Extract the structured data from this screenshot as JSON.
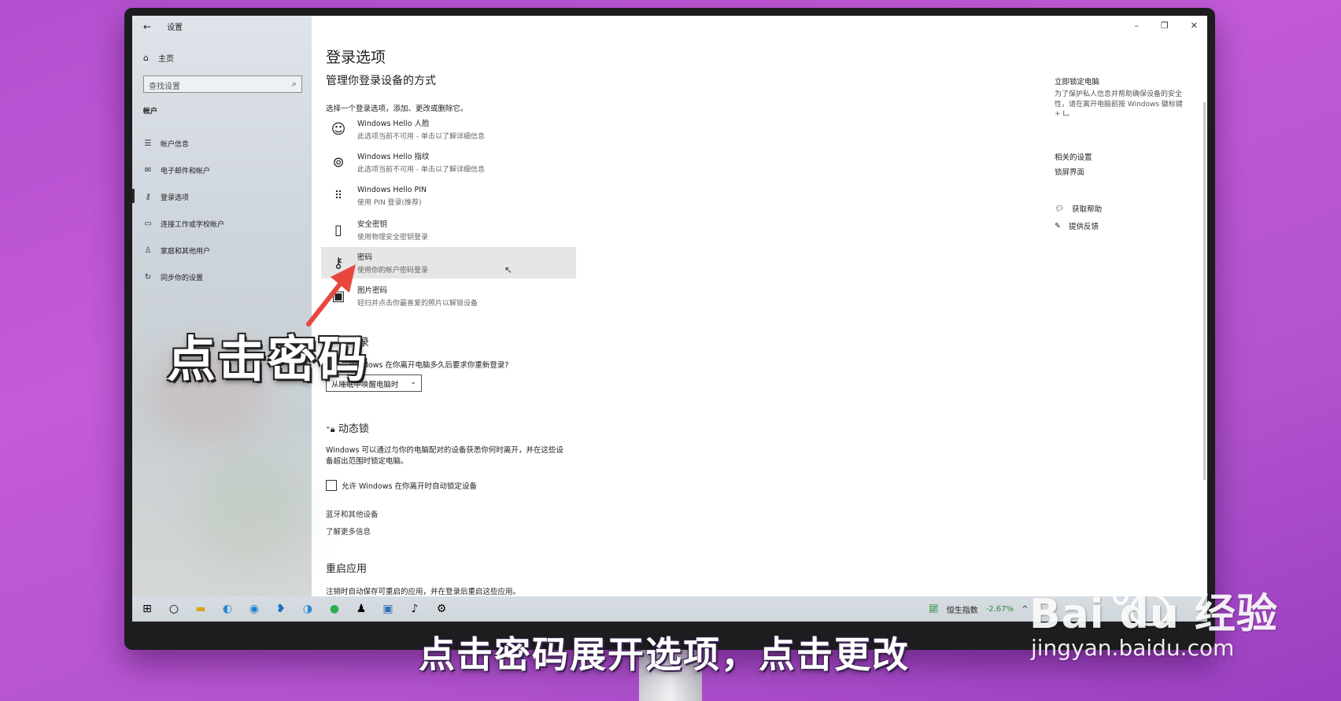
{
  "window": {
    "back_icon": "back-arrow-icon",
    "title": "设置",
    "minimize": "–",
    "restore": "❐",
    "close": "✕"
  },
  "sidebar": {
    "home_label": "主页",
    "search_placeholder": "查找设置",
    "section_label": "帐户",
    "items": [
      {
        "label": "帐户信息",
        "icon": "person-card-icon"
      },
      {
        "label": "电子邮件和帐户",
        "icon": "mail-icon"
      },
      {
        "label": "登录选项",
        "icon": "key-icon"
      },
      {
        "label": "连接工作或学校帐户",
        "icon": "briefcase-icon"
      },
      {
        "label": "家庭和其他用户",
        "icon": "person-icon"
      },
      {
        "label": "同步你的设置",
        "icon": "sync-icon"
      }
    ],
    "selected_index": 2
  },
  "main": {
    "title": "登录选项",
    "subtitle": "管理你登录设备的方式",
    "choose_text": "选择一个登录选项，添加、更改或删除它。",
    "options": [
      {
        "title": "Windows Hello 人脸",
        "sub": "此选项当前不可用 - 单击以了解详细信息",
        "icon": "face-icon"
      },
      {
        "title": "Windows Hello 指纹",
        "sub": "此选项当前不可用 - 单击以了解详细信息",
        "icon": "fingerprint-icon"
      },
      {
        "title": "Windows Hello PIN",
        "sub": "使用 PIN 登录(推荐)",
        "icon": "pin-keypad-icon"
      },
      {
        "title": "安全密钥",
        "sub": "使用物理安全密钥登录",
        "icon": "usb-key-icon"
      },
      {
        "title": "密码",
        "sub": "使用你的帐户密码登录",
        "icon": "key-icon"
      },
      {
        "title": "图片密码",
        "sub": "轻扫并点击你最喜爱的照片以解锁设备",
        "icon": "picture-icon"
      }
    ],
    "require_heading_partial": "录",
    "require_question": "Windows 在你离开电脑多久后要求你重新登录?",
    "require_dropdown_value": "从睡眠中唤醒电脑时",
    "dynamic_lock_heading": "动态锁",
    "dynamic_lock_desc_1": "Windows 可以通过与你的电脑配对的设备获悉你何时离开，并在这些设",
    "dynamic_lock_desc_2": "备超出范围时锁定电脑。",
    "dynamic_lock_checkbox": "允许 Windows 在你离开时自动锁定设备",
    "bt_link": "蓝牙和其他设备",
    "more_info_link": "了解更多信息",
    "restart_heading": "重启应用",
    "restart_desc": "注销时自动保存可重启的应用，并在登录后重启这些应用。"
  },
  "right": {
    "lock_now_title": "立即锁定电脑",
    "lock_now_desc": "为了保护私人信息并帮助确保设备的安全性，请在离开电脑前按 Windows 徽标键 + L。",
    "related_title": "相关的设置",
    "related_link": "锁屏界面",
    "help_label": "获取帮助",
    "feedback_label": "提供反馈"
  },
  "taskbar": {
    "stock_name": "恒生指数",
    "stock_change": "-2.67%",
    "overflow": "^"
  },
  "overlay": {
    "callout": "点击密码",
    "subtitle": "点击密码展开选项，点击更改"
  },
  "watermark": {
    "logo": "Bai du 经验",
    "url": "jingyan.baidu.com"
  },
  "colors": {
    "background_purple": "#c45ad8",
    "arrow_red": "#e8473f",
    "sidebar_bg": "#cfd6db",
    "selected_option_bg": "#e6e6e6"
  }
}
